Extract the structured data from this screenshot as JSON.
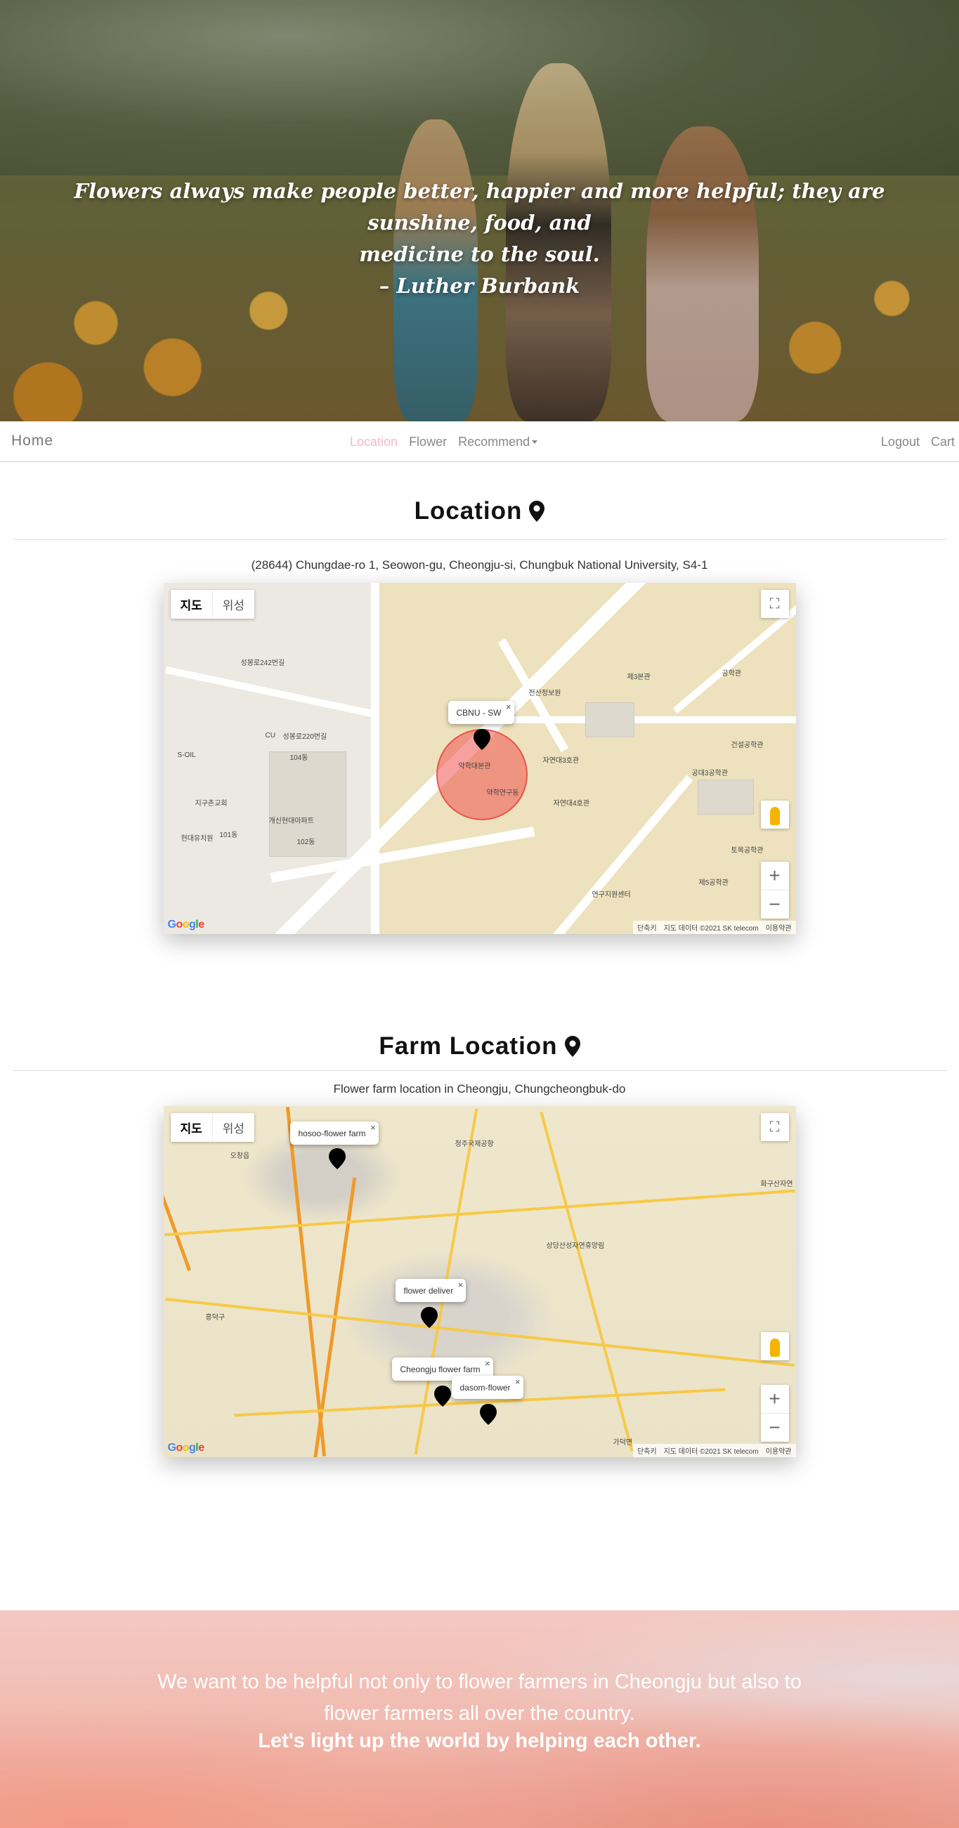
{
  "hero": {
    "quote_line1": "Flowers always make people better, happier and more helpful; they are sunshine, food, and",
    "quote_line2": "medicine to the soul.",
    "quote_author": "– Luther Burbank"
  },
  "nav": {
    "brand": "Home",
    "items": [
      {
        "label": "Location",
        "active": true
      },
      {
        "label": "Flower",
        "active": false
      },
      {
        "label": "Recommend",
        "active": false
      }
    ],
    "right": [
      {
        "label": "Logout"
      },
      {
        "label": "Cart"
      }
    ]
  },
  "location": {
    "title": "Location",
    "address": "(28644) Chungdae-ro 1, Seowon-gu, Cheongju-si, Chungbuk National University, S4-1",
    "map": {
      "type_map": "지도",
      "type_satellite": "위성",
      "info_label": "CBNU - SW",
      "labels": [
        "성봉로242번길",
        "성봉로220번길",
        "104동",
        "102동",
        "101동",
        "개신현대아파트",
        "지구촌교회",
        "현대유치원",
        "S-OIL",
        "CU",
        "약학대본관",
        "약학연구동",
        "자연대3호관",
        "자연대4호관",
        "제3본관",
        "공학관",
        "전산정보원",
        "연구지원센터",
        "건설공학관",
        "제5공학관",
        "토목공학관",
        "공대3공학관"
      ],
      "attribution": [
        "단축키",
        "지도 데이터 ©2021 SK telecom",
        "이용약관"
      ]
    }
  },
  "farm": {
    "title": "Farm Location",
    "subtitle": "Flower farm location in Cheongju, Chungcheongbuk-do",
    "map": {
      "type_map": "지도",
      "type_satellite": "위성",
      "infos": [
        {
          "label": "hosoo-flower farm"
        },
        {
          "label": "flower deliver"
        },
        {
          "label": "Cheongju flower farm"
        },
        {
          "label": "dasom-flower"
        }
      ],
      "labels": [
        "청주국제공항",
        "상당산성자연휴양림",
        "흥덕구",
        "오창읍",
        "가덕면",
        "화구산자연"
      ],
      "attribution": [
        "단축키",
        "지도 데이터 ©2021 SK telecom",
        "이용약관"
      ]
    }
  },
  "footer": {
    "line1": "We want to be helpful not only to flower farmers in Cheongju but also to",
    "line2": "flower farmers all over the country.",
    "line3": "Let's light up the world by helping each other."
  },
  "colors": {
    "nav_active": "#f7b6c8",
    "nav_border": "#f4c2cf",
    "marker": "#000000",
    "radius_circle": "#ef5350"
  }
}
